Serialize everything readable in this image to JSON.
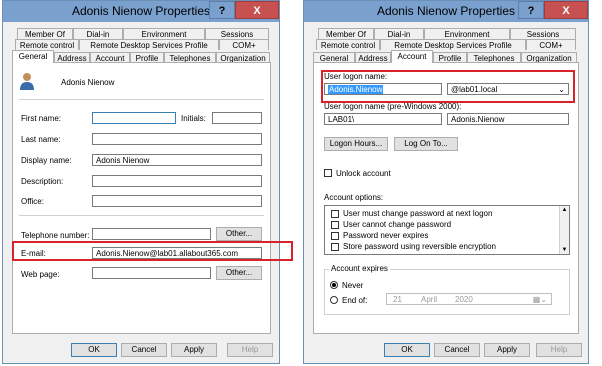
{
  "left_window": {
    "title": "Adonis Nienow Properties",
    "help": "?",
    "close": "X",
    "tabs_row1": [
      "Member Of",
      "Dial-in",
      "Environment",
      "Sessions"
    ],
    "tabs_row2": [
      "Remote control",
      "Remote Desktop Services Profile",
      "COM+"
    ],
    "tabs_row3": [
      "General",
      "Address",
      "Account",
      "Profile",
      "Telephones",
      "Organization"
    ],
    "active_tab": "General",
    "display_header": "Adonis Nienow",
    "fields": {
      "first_name_label": "First name:",
      "first_name": "",
      "initials_label": "Initials:",
      "initials": "",
      "last_name_label": "Last name:",
      "last_name": "",
      "display_name_label": "Display name:",
      "display_name": "Adonis Nienow",
      "description_label": "Description:",
      "description": "",
      "office_label": "Office:",
      "office": "",
      "telephone_label": "Telephone number:",
      "telephone": "",
      "email_label": "E-mail:",
      "email": "Adonis.Nienow@lab01.allabout365.com",
      "webpage_label": "Web page:",
      "webpage": ""
    },
    "other_button": "Other...",
    "buttons": [
      "OK",
      "Cancel",
      "Apply",
      "Help"
    ]
  },
  "right_window": {
    "title": "Adonis Nienow Properties",
    "help": "?",
    "close": "X",
    "tabs_row1": [
      "Member Of",
      "Dial-in",
      "Environment",
      "Sessions"
    ],
    "tabs_row2": [
      "Remote control",
      "Remote Desktop Services Profile",
      "COM+"
    ],
    "tabs_row3": [
      "General",
      "Address",
      "Account",
      "Profile",
      "Telephones",
      "Organization"
    ],
    "active_tab": "Account",
    "logon_name_label": "User logon name:",
    "logon_name": "Adonis.Nienow",
    "upn_suffix": "@lab01.local",
    "pre2000_label": "User logon name (pre-Windows 2000):",
    "pre2000_domain": "LAB01\\",
    "pre2000_name": "Adonis.Nienow",
    "logon_hours_button": "Logon Hours...",
    "logon_to_button": "Log On To...",
    "unlock_label": "Unlock account",
    "account_options_label": "Account options:",
    "account_options": [
      "User must change password at next logon",
      "User cannot change password",
      "Password never expires",
      "Store password using reversible encryption"
    ],
    "account_expires_label": "Account expires",
    "never_label": "Never",
    "end_of_label": "End of:",
    "end_of_date": {
      "day": "21",
      "month": "April",
      "year": "2020"
    },
    "buttons": [
      "OK",
      "Cancel",
      "Apply",
      "Help"
    ]
  },
  "colors": {
    "highlight_box": "#d9232a",
    "titlebar": "#7aa0cd",
    "close_button": "#c75050",
    "selection": "#3399ff"
  }
}
